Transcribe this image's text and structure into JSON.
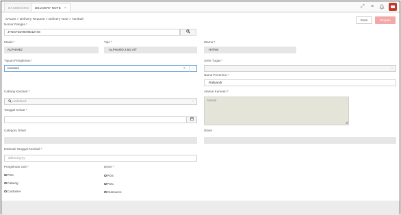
{
  "tabs": [
    {
      "label": "DASHBOARD"
    },
    {
      "label": "DELIVERY NOTE",
      "close": "×"
    }
  ],
  "header_icons": [
    "expand-icon",
    "menu-icon",
    "bell-icon",
    "user-avatar"
  ],
  "breadcrumb": "SALES > Delivery Request > Delivery Note > Tambah",
  "buttons": {
    "batal": "Batal",
    "simpan": "Simpan"
  },
  "form": {
    "nomor_rangka": {
      "label": "Nomor Rangka *",
      "value": "JTNGF3DH5H8012748"
    },
    "model": {
      "label": "Model *",
      "value": "ALPHARD"
    },
    "tipe": {
      "label": "Tipe *",
      "value": "ALPHARD 2.5G A/T"
    },
    "warna": {
      "label": "Warna *",
      "value": "HITAM"
    },
    "tujuan_pengiriman": {
      "label": "Tujuan Pengiriman *",
      "value": "Karoseri"
    },
    "jenis_tugas": {
      "label": "Jenis Tugas *",
      "value": ""
    },
    "nama_penerima": {
      "label": "Nama Penerima *",
      "value": "Rafiyandi"
    },
    "cabang_karoseri": {
      "label": "Cabang Karoseri *",
      "value": "undefined"
    },
    "alamat_karoseri": {
      "label": "Alamat Karoseri *",
      "placeholder": "Alamat"
    },
    "tanggal_keluar": {
      "label": "Tanggal Keluar *",
      "value": ""
    },
    "category_driver": {
      "label": "Category Driver",
      "value": ""
    },
    "driver": {
      "label": "Driver",
      "value": ""
    },
    "estimasi_tanggal_kembali": {
      "label": "Estimasi Tanggal Kembali *",
      "placeholder": "dd/mm/yyyy"
    },
    "pengiriman_unit": {
      "label": "Pengiriman Unit *",
      "options": [
        "PDC",
        "Cabang",
        "Customer"
      ]
    },
    "driver_radio": {
      "label": "Driver *",
      "options": [
        "PDS",
        "PDC",
        "Outsource"
      ]
    }
  },
  "colors": {
    "accent": "#6fa8dc",
    "save_button": "#f4a7a7",
    "avatar": "#c0392b",
    "readonly": "#e6e6e6"
  }
}
